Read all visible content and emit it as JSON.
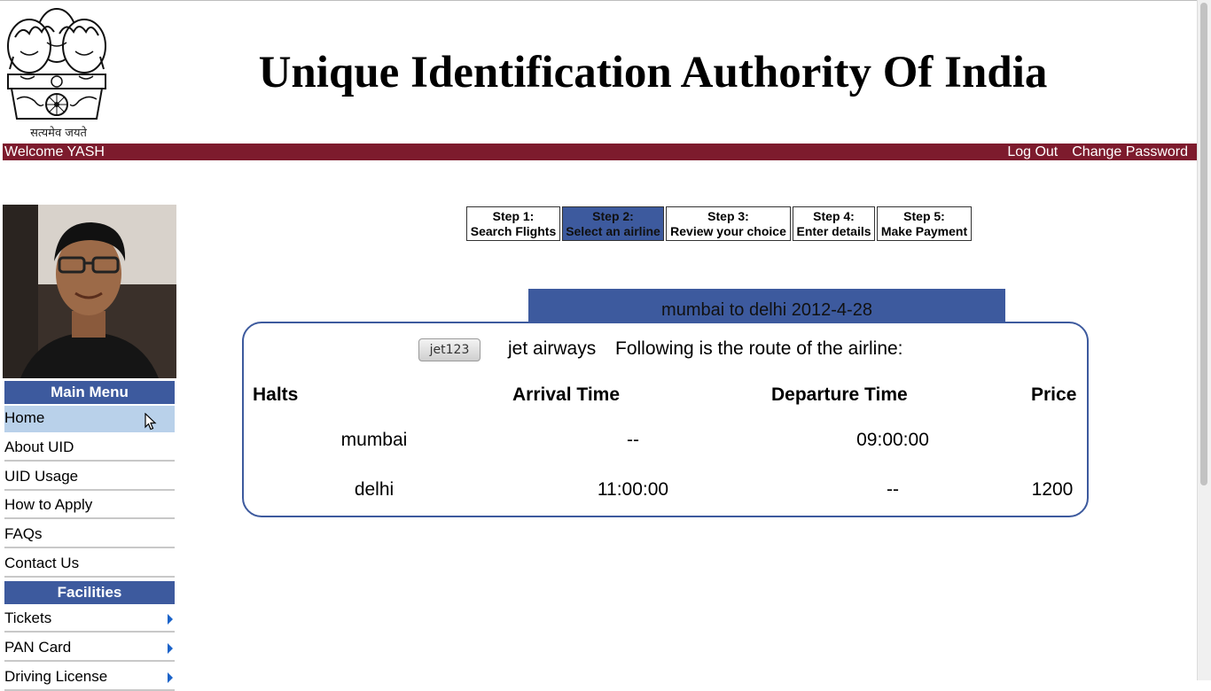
{
  "header": {
    "title": "Unique Identification Authority Of India",
    "motto": "सत्यमेव जयते"
  },
  "welcome_bar": {
    "welcome_text": "Welcome YASH",
    "logout_label": "Log Out",
    "change_password_label": "Change Password"
  },
  "sidebar": {
    "main_menu_title": "Main Menu",
    "main_menu_items": [
      {
        "label": "Home",
        "active": true
      },
      {
        "label": "About UID"
      },
      {
        "label": "UID Usage"
      },
      {
        "label": "How to Apply"
      },
      {
        "label": "FAQs"
      },
      {
        "label": "Contact Us"
      }
    ],
    "facilities_title": "Facilities",
    "facilities_items": [
      {
        "label": "Tickets"
      },
      {
        "label": "PAN Card"
      },
      {
        "label": "Driving License"
      }
    ]
  },
  "steps": [
    {
      "number": "Step 1:",
      "label": "Search Flights"
    },
    {
      "number": "Step 2:",
      "label": "Select an airline",
      "active": true
    },
    {
      "number": "Step 3:",
      "label": "Review your choice"
    },
    {
      "number": "Step 4:",
      "label": "Enter details"
    },
    {
      "number": "Step 5:",
      "label": "Make Payment"
    }
  ],
  "route": {
    "header": "mumbai to delhi 2012-4-28",
    "flight_button": "jet123",
    "airline_name": "jet airways",
    "note": "Following is the route of the airline:",
    "columns": [
      "Halts",
      "Arrival Time",
      "Departure Time",
      "Price"
    ],
    "rows": [
      {
        "halt": "mumbai",
        "arrival": "--",
        "departure": "09:00:00",
        "price": ""
      },
      {
        "halt": "delhi",
        "arrival": "11:00:00",
        "departure": "--",
        "price": "1200"
      }
    ]
  },
  "colors": {
    "accent_blue": "#3d5a9e",
    "bar_maroon": "#7d1b2d",
    "active_menu": "#b9d1ea"
  }
}
